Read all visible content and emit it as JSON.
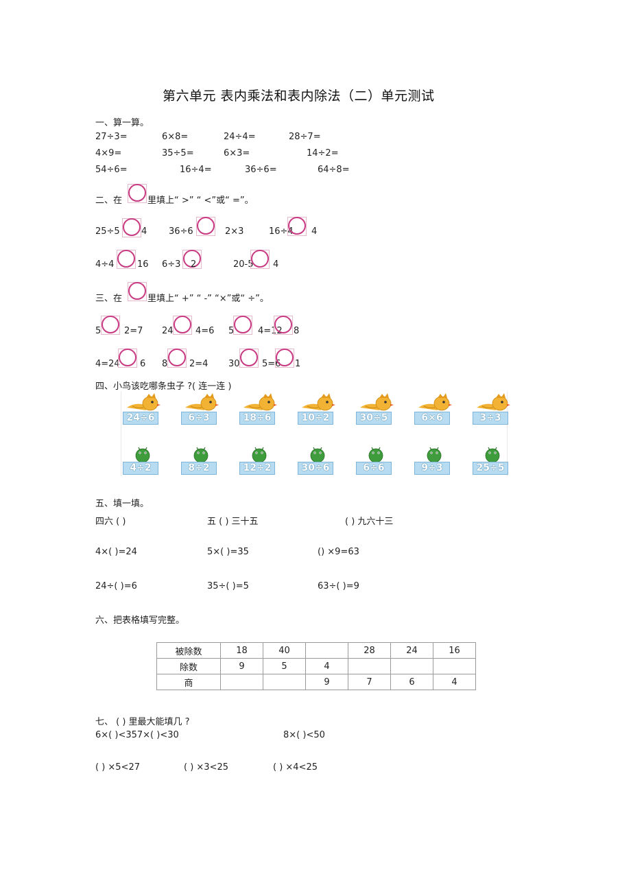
{
  "title": "第六单元   表内乘法和表内除法（二）单元测试",
  "s1": {
    "heading": "一、算一算。",
    "rows": [
      [
        "27÷3=",
        "6×8=",
        "24÷4=",
        "28÷7="
      ],
      [
        "4×9=",
        "35÷5=",
        "6×3=",
        "14÷2="
      ],
      [
        "54÷6=",
        "16÷4=",
        "36÷6=",
        "64÷8="
      ]
    ]
  },
  "s2": {
    "heading_pre": "二、在",
    "heading_post": "里填上“ >”  “ <”或“ =”。",
    "row1": [
      "25÷5",
      "4",
      "36÷6",
      "2×3",
      "16÷4",
      "4"
    ],
    "row2": [
      "4÷4",
      "16",
      "6÷3",
      "2",
      "20-5",
      "4"
    ]
  },
  "s3": {
    "heading_pre": "三、在",
    "heading_post": "里填上“ +”  “ -”  “×”或“ ÷”。",
    "row1": [
      "5",
      "2=7",
      "24",
      "4=6",
      "5",
      "4=12",
      "8"
    ],
    "row2": [
      "4=24",
      "6",
      "8",
      "2=4",
      "30",
      "5=6",
      "1"
    ]
  },
  "s4": {
    "heading": "四、小鸟该吃哪条虫子    ?( 连一连 )",
    "birds": [
      "24÷6",
      "6÷3",
      "18÷6",
      "10÷2",
      "30÷5",
      "6×6",
      "3÷3"
    ],
    "worms": [
      "4÷2",
      "8÷2",
      "12÷2",
      "30÷6",
      "6÷6",
      "9÷3",
      "25÷5"
    ],
    "colors": {
      "bird": "#f2b233",
      "worm": "#3f9c3c",
      "card": "#b7dcf1"
    }
  },
  "s5": {
    "heading": "五、填一填。",
    "row1": [
      "四六 (        )",
      "五 (        ) 三十五",
      "(        ) 九六十三"
    ],
    "row2": [
      "4×(        )=24",
      "5×(        )=35",
      "() ×9=63"
    ],
    "row3": [
      "24÷(        )=6",
      "35÷(        )=5",
      "63÷(        )=9"
    ]
  },
  "s6": {
    "heading": "六、把表格填写完整。",
    "table": [
      [
        "被除数",
        "18",
        "40",
        "",
        "28",
        "24",
        "16"
      ],
      [
        "除数",
        "9",
        "5",
        "4",
        "",
        "",
        ""
      ],
      [
        "商",
        "",
        "",
        "9",
        "7",
        "6",
        "4"
      ]
    ]
  },
  "s7": {
    "heading": "七、 (        ) 里最大能填几  ?",
    "row1": [
      "6×(        )<357×(                    )<30",
      "8×(        )<50"
    ],
    "row2": [
      "(        ) ×5<27",
      "(        ) ×3<25",
      "(        ) ×4<25"
    ]
  }
}
